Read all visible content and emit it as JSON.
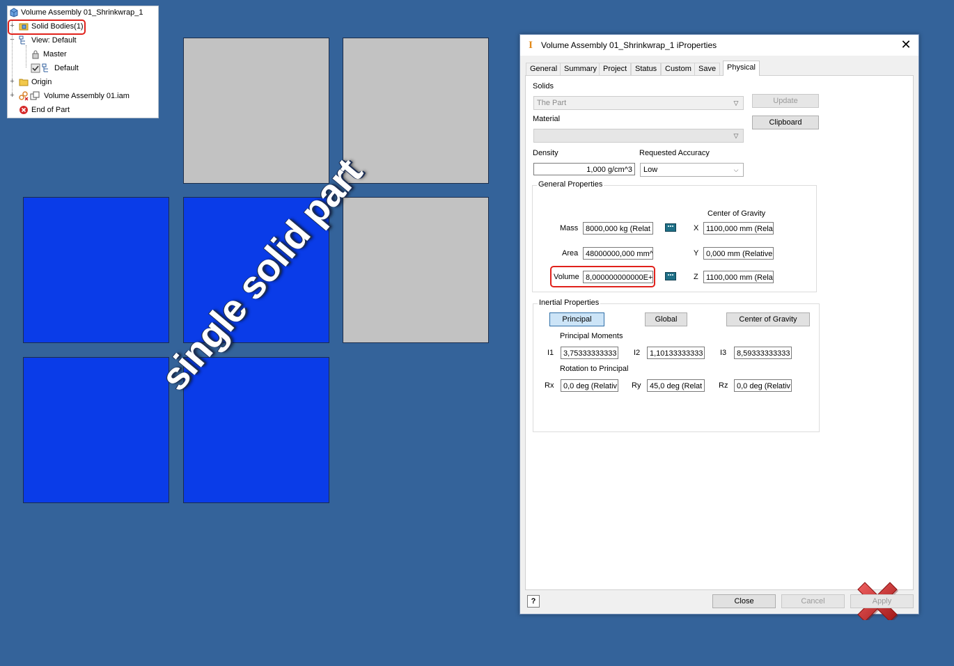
{
  "browser": {
    "root": "Volume Assembly 01_Shrinkwrap_1",
    "items": [
      {
        "label": "Solid Bodies(1)"
      },
      {
        "label": "View: Default"
      },
      {
        "label": "Master"
      },
      {
        "label": "Default"
      },
      {
        "label": "Origin"
      },
      {
        "label": "Volume Assembly 01.iam"
      },
      {
        "label": "End of Part"
      }
    ]
  },
  "overlay_text": "single solid part",
  "dialog": {
    "title": "Volume Assembly 01_Shrinkwrap_1 iProperties",
    "tabs": [
      "General",
      "Summary",
      "Project",
      "Status",
      "Custom",
      "Save",
      "Physical"
    ],
    "active_tab": "Physical",
    "solids_label": "Solids",
    "solids_value": "The Part",
    "material_label": "Material",
    "material_value": "",
    "update_label": "Update",
    "clipboard_label": "Clipboard",
    "density_label": "Density",
    "density_value": "1,000 g/cm^3",
    "accuracy_label": "Requested Accuracy",
    "accuracy_value": "Low",
    "general_props": {
      "title": "General Properties",
      "cog_title": "Center of Gravity",
      "mass_label": "Mass",
      "mass_value": "8000,000 kg (Relat",
      "area_label": "Area",
      "area_value": "48000000,000 mm^",
      "volume_label": "Volume",
      "volume_value": "8,000000000000E+",
      "x_label": "X",
      "x_value": "1100,000 mm (Rela",
      "y_label": "Y",
      "y_value": "0,000 mm (Relative",
      "z_label": "Z",
      "z_value": "1100,000 mm (Rela"
    },
    "inertial": {
      "title": "Inertial Properties",
      "buttons": [
        "Principal",
        "Global",
        "Center of Gravity"
      ],
      "moments_label": "Principal Moments",
      "i1_label": "I1",
      "i1_value": "3,75333333333",
      "i2_label": "I2",
      "i2_value": "1,10133333333",
      "i3_label": "I3",
      "i3_value": "8,59333333333",
      "rotation_label": "Rotation to Principal",
      "rx_label": "Rx",
      "rx_value": "0,0 deg (Relativ",
      "ry_label": "Ry",
      "ry_value": "45,0 deg (Relat",
      "rz_label": "Rz",
      "rz_value": "0,0 deg (Relativ"
    },
    "footer": {
      "help": "?",
      "close": "Close",
      "cancel": "Cancel",
      "apply": "Apply"
    }
  },
  "colors": {
    "background": "#34639a",
    "solid_blue": "#0a3ce8",
    "tile_gray": "#c2c2c2",
    "highlight_red": "#e0211b"
  }
}
